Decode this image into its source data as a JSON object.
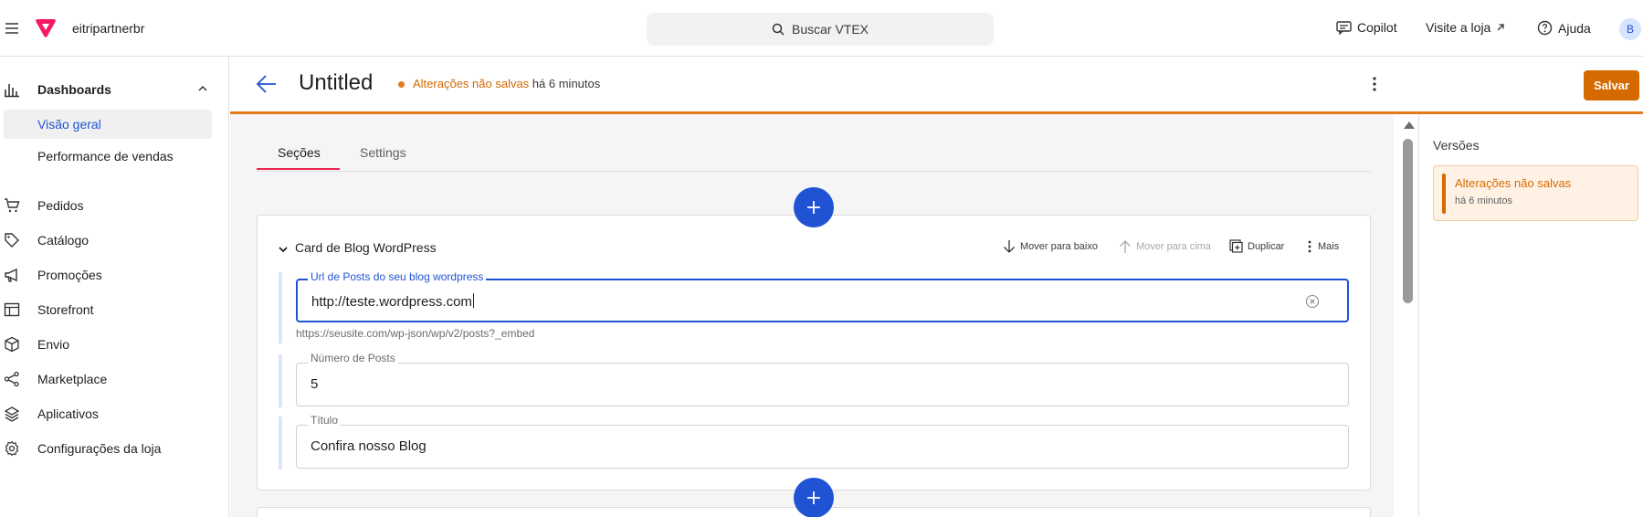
{
  "topbar": {
    "account": "eitripartnerbr",
    "search_label": "Buscar VTEX",
    "copilot": "Copilot",
    "visit_store": "Visite a loja",
    "help": "Ajuda",
    "avatar_initial": "B"
  },
  "sidebar": {
    "dashboards": "Dashboards",
    "sub_items": [
      "Visão geral",
      "Performance de vendas"
    ],
    "items": [
      {
        "label": "Pedidos",
        "icon": "cart-icon"
      },
      {
        "label": "Catálogo",
        "icon": "tag-icon"
      },
      {
        "label": "Promoções",
        "icon": "megaphone-icon"
      },
      {
        "label": "Storefront",
        "icon": "layout-icon"
      },
      {
        "label": "Envio",
        "icon": "box-icon"
      },
      {
        "label": "Marketplace",
        "icon": "share-icon"
      },
      {
        "label": "Aplicativos",
        "icon": "layers-icon"
      },
      {
        "label": "Configurações da loja",
        "icon": "gear-icon"
      }
    ]
  },
  "editor": {
    "title": "Untitled",
    "status_unsaved": "Alterações não salvas",
    "status_time": "há 6 minutos",
    "save": "Salvar",
    "tabs": [
      "Seções",
      "Settings"
    ]
  },
  "card": {
    "title": "Card de Blog WordPress",
    "actions": {
      "move_down": "Mover para baixo",
      "move_up": "Mover para cima",
      "duplicate": "Duplicar",
      "more": "Mais"
    },
    "fields": [
      {
        "label": "Url de Posts do seu blog wordpress",
        "value": "http://teste.wordpress.com",
        "hint": "https://seusite.com/wp-json/wp/v2/posts?_embed"
      },
      {
        "label": "Número de Posts",
        "value": "5"
      },
      {
        "label": "Título",
        "value": "Confira nosso Blog"
      }
    ]
  },
  "versions": {
    "title": "Versões",
    "entry_title": "Alterações não salvas",
    "entry_time": "há 6 minutos"
  },
  "colors": {
    "accent": "#2053d4",
    "warning": "#d46a00",
    "tab_underline": "#e8264f",
    "brand": "#f71963"
  }
}
